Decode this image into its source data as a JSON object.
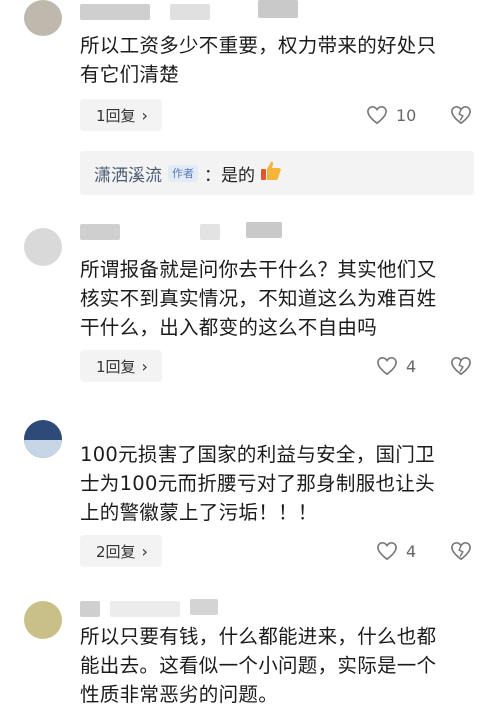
{
  "comments": [
    {
      "text_lines": [
        "所以工资多少不重要，权力带来的好处只",
        "有它们清楚"
      ],
      "reply_label": "1回复",
      "likes": "10",
      "sub_reply": {
        "name": "潇洒溪流",
        "tag": "作者",
        "sep": "：",
        "text": "是的"
      }
    },
    {
      "text_lines": [
        "所谓报备就是问你去干什么？其实他们又",
        "核实不到真实情况，不知道这么为难百姓",
        "干什么，出入都变的这么不自由吗"
      ],
      "reply_label": "1回复",
      "likes": "4"
    },
    {
      "text_lines": [
        "100元损害了国家的利益与安全，国门卫",
        "士为100元而折腰亏对了那身制服也让头",
        "上的警徽蒙上了污垢！！！"
      ],
      "reply_label": "2回复",
      "likes": "4"
    },
    {
      "text_lines": [
        "所以只要有钱，什么都能进来，什么也都",
        "能出去。这看似一个小问题，实际是一个",
        "性质非常恶劣的问题。"
      ]
    }
  ],
  "icons": {
    "heart": "heart-outline-icon",
    "dislike": "broken-heart-icon",
    "chevron": "chevron-right-icon",
    "thumb": "thumbs-up-emoji"
  },
  "colors": {
    "reply_bg": "#f3f3f3",
    "name": "#4a5a72",
    "tag_bg": "#e3ebf7"
  }
}
